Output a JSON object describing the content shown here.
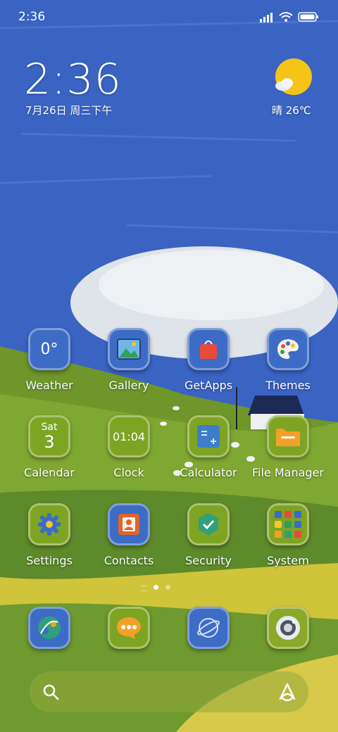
{
  "status_bar": {
    "time": "2:36",
    "icons": [
      "signal-icon",
      "wifi-icon",
      "battery-icon"
    ]
  },
  "clock_widget": {
    "time": "2:36",
    "date": "7月26日 周三下午"
  },
  "weather_widget": {
    "text": "晴 26℃",
    "icon": "sun-cloud-icon"
  },
  "apps": [
    {
      "label": "Weather",
      "tile_text": "0°",
      "icon": "weather-icon"
    },
    {
      "label": "Gallery",
      "icon": "gallery-icon"
    },
    {
      "label": "GetApps",
      "icon": "shopping-bag-icon"
    },
    {
      "label": "Themes",
      "icon": "palette-icon"
    },
    {
      "label": "Calendar",
      "tile_top": "Sat",
      "tile_bottom": "3",
      "icon": "calendar-icon"
    },
    {
      "label": "Clock",
      "tile_text": "01:04",
      "icon": "clock-icon"
    },
    {
      "label": "Calculator",
      "icon": "calculator-icon"
    },
    {
      "label": "File Manager",
      "icon": "folder-icon"
    },
    {
      "label": "Settings",
      "icon": "gear-icon"
    },
    {
      "label": "Contacts",
      "icon": "contact-card-icon"
    },
    {
      "label": "Security",
      "icon": "shield-icon"
    },
    {
      "label": "System",
      "icon": "folder-grid-icon"
    }
  ],
  "page_indicator": {
    "pages": 2,
    "current": 1
  },
  "dock": [
    {
      "icon": "browser-icon"
    },
    {
      "icon": "messaging-icon"
    },
    {
      "icon": "planet-icon"
    },
    {
      "icon": "camera-icon"
    }
  ],
  "search": {
    "icon": "search-icon",
    "assistant_icon": "assistant-icon"
  }
}
